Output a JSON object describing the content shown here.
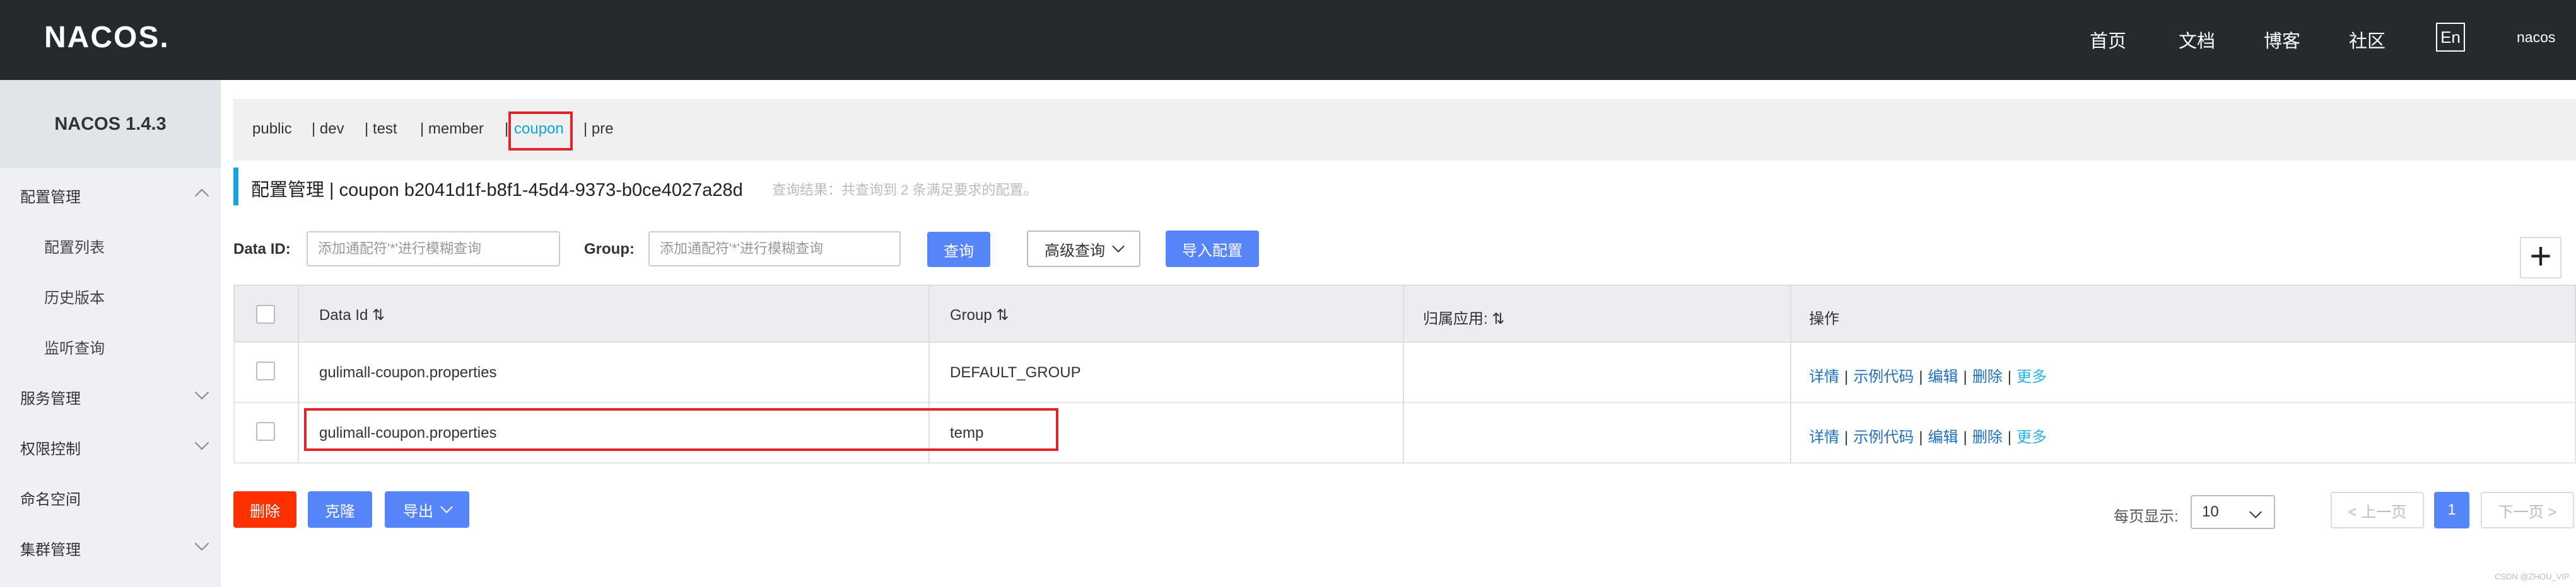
{
  "header": {
    "logo": "NACOS.",
    "nav": [
      "首页",
      "文档",
      "博客",
      "社区"
    ],
    "lang": "En",
    "user": "nacos"
  },
  "sidebar": {
    "version": "NACOS 1.4.3",
    "items": [
      {
        "label": "配置管理",
        "chevron": "up"
      },
      {
        "label": "配置列表"
      },
      {
        "label": "历史版本"
      },
      {
        "label": "监听查询"
      },
      {
        "label": "服务管理",
        "chevron": "down"
      },
      {
        "label": "权限控制",
        "chevron": "down"
      },
      {
        "label": "命名空间"
      },
      {
        "label": "集群管理",
        "chevron": "down"
      }
    ]
  },
  "namespaces": [
    "public",
    "| dev",
    "| test",
    "| member",
    "|",
    "coupon",
    "| pre"
  ],
  "active_namespace": "coupon",
  "page": {
    "title": "配置管理 | coupon  b2041d1f-b8f1-45d4-9373-b0ce4027a28d",
    "note": "查询结果：共查询到 2 条满足要求的配置。"
  },
  "filters": {
    "dataid_label": "Data ID:",
    "dataid_placeholder": "添加通配符'*'进行模糊查询",
    "group_label": "Group:",
    "group_placeholder": "添加通配符'*'进行模糊查询",
    "query_button": "查询",
    "advanced_button": "高级查询",
    "import_button": "导入配置",
    "add_icon": "plus-icon"
  },
  "table": {
    "headers": [
      "Data Id",
      "Group",
      "归属应用:",
      "操作"
    ],
    "rows": [
      {
        "dataid": "gulimall-coupon.properties",
        "group": "DEFAULT_GROUP",
        "app": "",
        "actions": [
          "详情",
          "示例代码",
          "编辑",
          "删除",
          "更多"
        ]
      },
      {
        "dataid": "gulimall-coupon.properties",
        "group": "temp",
        "app": "",
        "actions": [
          "详情",
          "示例代码",
          "编辑",
          "删除",
          "更多"
        ]
      }
    ]
  },
  "bottom": {
    "delete_button": "删除",
    "clone_button": "克隆",
    "export_button": "导出",
    "page_size_label": "每页显示:",
    "page_size": "10",
    "prev": "< 上一页",
    "current_page": "1",
    "next": "下一页 >"
  },
  "watermark": "CSDN @ZHOU_VIP",
  "colors": {
    "accent": "#5585f8",
    "danger": "#ff3000",
    "highlight_box": "#e0242a",
    "topbar": "#252a2f"
  }
}
